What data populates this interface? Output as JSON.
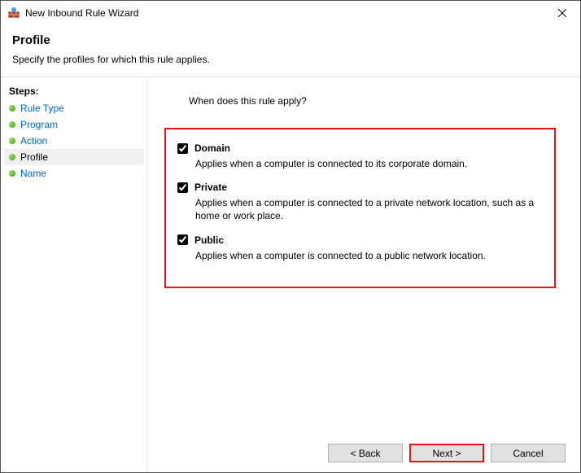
{
  "window": {
    "title": "New Inbound Rule Wizard"
  },
  "header": {
    "title": "Profile",
    "subtitle": "Specify the profiles for which this rule applies."
  },
  "sidebar": {
    "title": "Steps:",
    "items": [
      {
        "label": "Rule Type"
      },
      {
        "label": "Program"
      },
      {
        "label": "Action"
      },
      {
        "label": "Profile"
      },
      {
        "label": "Name"
      }
    ]
  },
  "content": {
    "prompt": "When does this rule apply?",
    "options": [
      {
        "label": "Domain",
        "description": "Applies when a computer is connected to its corporate domain.",
        "checked": true
      },
      {
        "label": "Private",
        "description": "Applies when a computer is connected to a private network location, such as a home or work place.",
        "checked": true
      },
      {
        "label": "Public",
        "description": "Applies when a computer is connected to a public network location.",
        "checked": true
      }
    ]
  },
  "footer": {
    "back": "< Back",
    "next": "Next >",
    "cancel": "Cancel"
  }
}
